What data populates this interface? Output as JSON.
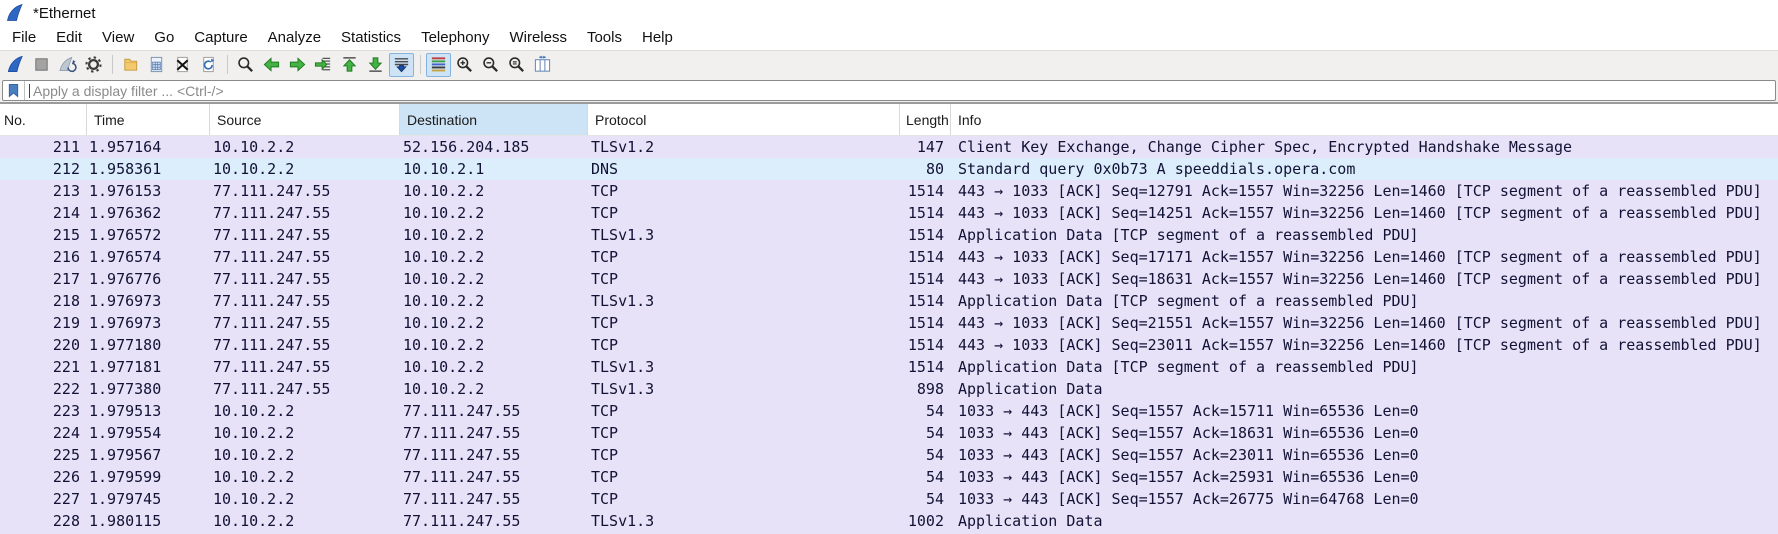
{
  "window": {
    "title": "*Ethernet",
    "app_icon": "wireshark-fin-icon"
  },
  "menu": {
    "items": [
      "File",
      "Edit",
      "View",
      "Go",
      "Capture",
      "Analyze",
      "Statistics",
      "Telephony",
      "Wireless",
      "Tools",
      "Help"
    ]
  },
  "toolbar": {
    "buttons": [
      {
        "name": "start-capture",
        "icon": "shark-fin"
      },
      {
        "name": "stop-capture",
        "icon": "stop-square"
      },
      {
        "name": "restart-capture",
        "icon": "fin-restart"
      },
      {
        "name": "capture-options",
        "icon": "gear"
      },
      {
        "sep": true
      },
      {
        "name": "open-file",
        "icon": "folder-open"
      },
      {
        "name": "save-file",
        "icon": "save-doc"
      },
      {
        "name": "close-file",
        "icon": "close-doc"
      },
      {
        "name": "reload-file",
        "icon": "reload-doc"
      },
      {
        "sep": true
      },
      {
        "name": "find-packet",
        "icon": "magnifier"
      },
      {
        "name": "go-back",
        "icon": "arrow-left"
      },
      {
        "name": "go-forward",
        "icon": "arrow-right"
      },
      {
        "name": "go-to-packet",
        "icon": "arrow-goto"
      },
      {
        "name": "go-first",
        "icon": "arrow-up-bar"
      },
      {
        "name": "go-last",
        "icon": "arrow-down-bar"
      },
      {
        "name": "auto-scroll",
        "icon": "autoscroll-lines",
        "active": true
      },
      {
        "sep": true
      },
      {
        "name": "colorize",
        "icon": "colorize-lines",
        "active": true
      },
      {
        "name": "zoom-in",
        "icon": "magnifier-plus"
      },
      {
        "name": "zoom-out",
        "icon": "magnifier-minus"
      },
      {
        "name": "zoom-normal",
        "icon": "magnifier-equal"
      },
      {
        "name": "resize-columns",
        "icon": "resize-columns"
      }
    ]
  },
  "filter": {
    "placeholder": "Apply a display filter ... <Ctrl-/>"
  },
  "table": {
    "columns": [
      {
        "label": "No."
      },
      {
        "label": "Time"
      },
      {
        "label": "Source"
      },
      {
        "label": "Destination",
        "selected": true
      },
      {
        "label": "Protocol"
      },
      {
        "label": "Length"
      },
      {
        "label": "Info"
      }
    ]
  },
  "packets": [
    {
      "no": "211",
      "time": "1.957164",
      "source": "10.10.2.2",
      "destination": "52.156.204.185",
      "protocol": "TLSv1.2",
      "length": "147",
      "info": "Client Key Exchange, Change Cipher Spec, Encrypted Handshake Message",
      "type": "tcp"
    },
    {
      "no": "212",
      "time": "1.958361",
      "source": "10.10.2.2",
      "destination": "10.10.2.1",
      "protocol": "DNS",
      "length": "80",
      "info": "Standard query 0x0b73 A speeddials.opera.com",
      "type": "dns"
    },
    {
      "no": "213",
      "time": "1.976153",
      "source": "77.111.247.55",
      "destination": "10.10.2.2",
      "protocol": "TCP",
      "length": "1514",
      "info": "443 → 1033 [ACK] Seq=12791 Ack=1557 Win=32256 Len=1460 [TCP segment of a reassembled PDU]",
      "type": "tcp"
    },
    {
      "no": "214",
      "time": "1.976362",
      "source": "77.111.247.55",
      "destination": "10.10.2.2",
      "protocol": "TCP",
      "length": "1514",
      "info": "443 → 1033 [ACK] Seq=14251 Ack=1557 Win=32256 Len=1460 [TCP segment of a reassembled PDU]",
      "type": "tcp"
    },
    {
      "no": "215",
      "time": "1.976572",
      "source": "77.111.247.55",
      "destination": "10.10.2.2",
      "protocol": "TLSv1.3",
      "length": "1514",
      "info": "Application Data [TCP segment of a reassembled PDU]",
      "type": "tcp"
    },
    {
      "no": "216",
      "time": "1.976574",
      "source": "77.111.247.55",
      "destination": "10.10.2.2",
      "protocol": "TCP",
      "length": "1514",
      "info": "443 → 1033 [ACK] Seq=17171 Ack=1557 Win=32256 Len=1460 [TCP segment of a reassembled PDU]",
      "type": "tcp"
    },
    {
      "no": "217",
      "time": "1.976776",
      "source": "77.111.247.55",
      "destination": "10.10.2.2",
      "protocol": "TCP",
      "length": "1514",
      "info": "443 → 1033 [ACK] Seq=18631 Ack=1557 Win=32256 Len=1460 [TCP segment of a reassembled PDU]",
      "type": "tcp"
    },
    {
      "no": "218",
      "time": "1.976973",
      "source": "77.111.247.55",
      "destination": "10.10.2.2",
      "protocol": "TLSv1.3",
      "length": "1514",
      "info": "Application Data [TCP segment of a reassembled PDU]",
      "type": "tcp"
    },
    {
      "no": "219",
      "time": "1.976973",
      "source": "77.111.247.55",
      "destination": "10.10.2.2",
      "protocol": "TCP",
      "length": "1514",
      "info": "443 → 1033 [ACK] Seq=21551 Ack=1557 Win=32256 Len=1460 [TCP segment of a reassembled PDU]",
      "type": "tcp"
    },
    {
      "no": "220",
      "time": "1.977180",
      "source": "77.111.247.55",
      "destination": "10.10.2.2",
      "protocol": "TCP",
      "length": "1514",
      "info": "443 → 1033 [ACK] Seq=23011 Ack=1557 Win=32256 Len=1460 [TCP segment of a reassembled PDU]",
      "type": "tcp"
    },
    {
      "no": "221",
      "time": "1.977181",
      "source": "77.111.247.55",
      "destination": "10.10.2.2",
      "protocol": "TLSv1.3",
      "length": "1514",
      "info": "Application Data [TCP segment of a reassembled PDU]",
      "type": "tcp"
    },
    {
      "no": "222",
      "time": "1.977380",
      "source": "77.111.247.55",
      "destination": "10.10.2.2",
      "protocol": "TLSv1.3",
      "length": "898",
      "info": "Application Data",
      "type": "tcp"
    },
    {
      "no": "223",
      "time": "1.979513",
      "source": "10.10.2.2",
      "destination": "77.111.247.55",
      "protocol": "TCP",
      "length": "54",
      "info": "1033 → 443 [ACK] Seq=1557 Ack=15711 Win=65536 Len=0",
      "type": "tcp"
    },
    {
      "no": "224",
      "time": "1.979554",
      "source": "10.10.2.2",
      "destination": "77.111.247.55",
      "protocol": "TCP",
      "length": "54",
      "info": "1033 → 443 [ACK] Seq=1557 Ack=18631 Win=65536 Len=0",
      "type": "tcp"
    },
    {
      "no": "225",
      "time": "1.979567",
      "source": "10.10.2.2",
      "destination": "77.111.247.55",
      "protocol": "TCP",
      "length": "54",
      "info": "1033 → 443 [ACK] Seq=1557 Ack=23011 Win=65536 Len=0",
      "type": "tcp"
    },
    {
      "no": "226",
      "time": "1.979599",
      "source": "10.10.2.2",
      "destination": "77.111.247.55",
      "protocol": "TCP",
      "length": "54",
      "info": "1033 → 443 [ACK] Seq=1557 Ack=25931 Win=65536 Len=0",
      "type": "tcp"
    },
    {
      "no": "227",
      "time": "1.979745",
      "source": "10.10.2.2",
      "destination": "77.111.247.55",
      "protocol": "TCP",
      "length": "54",
      "info": "1033 → 443 [ACK] Seq=1557 Ack=26775 Win=64768 Len=0",
      "type": "tcp"
    },
    {
      "no": "228",
      "time": "1.980115",
      "source": "10.10.2.2",
      "destination": "77.111.247.55",
      "protocol": "TLSv1.3",
      "length": "1002",
      "info": "Application Data",
      "type": "tcp"
    }
  ],
  "colors": {
    "tcp_row_bg": "#e7e2f7",
    "dns_row_bg": "#dceefb",
    "row_text": "#121236",
    "header_selected_bg": "#cde4f7",
    "active_button_bg": "#cfe3f7",
    "accent_green": "#44b244",
    "accent_blue": "#2f6db8"
  }
}
